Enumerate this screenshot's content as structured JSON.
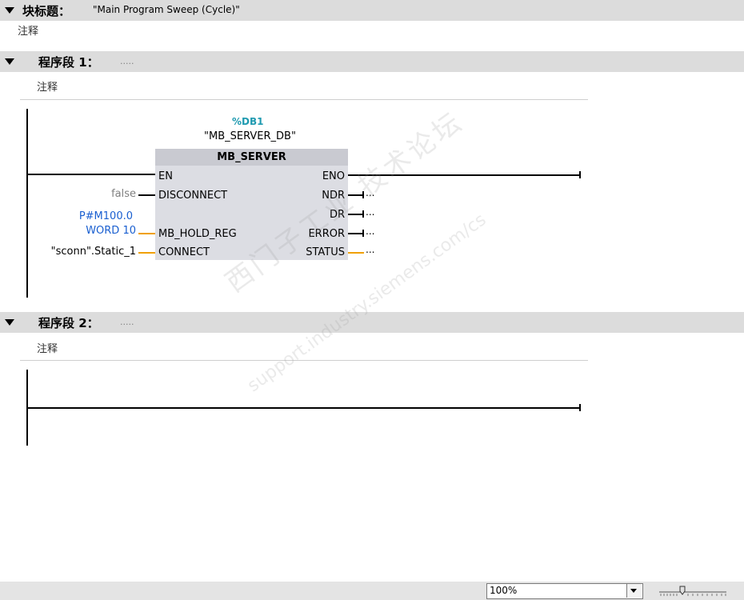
{
  "block": {
    "title_label": "块标题：",
    "title_value": "\"Main Program Sweep (Cycle)\"",
    "comment": "注释"
  },
  "networks": [
    {
      "label": "程序段 1：",
      "dots": ".....",
      "comment": "注释"
    },
    {
      "label": "程序段 2：",
      "dots": ".....",
      "comment": "注释"
    }
  ],
  "fb": {
    "db_address": "%DB1",
    "db_name": "\"MB_SERVER_DB\"",
    "name": "MB_SERVER",
    "inputs": {
      "en": "EN",
      "disconnect": "DISCONNECT",
      "mb_hold_reg": "MB_HOLD_REG",
      "connect": "CONNECT"
    },
    "outputs": {
      "eno": "ENO",
      "ndr": "NDR",
      "dr": "DR",
      "error": "ERROR",
      "status": "STATUS"
    },
    "params": {
      "disconnect": "false",
      "hold_reg_line1": "P#M100.0",
      "hold_reg_line2": "WORD 10",
      "connect": "\"sconn\".Static_1"
    },
    "open_output": "..."
  },
  "watermark": {
    "cn": "西门子工业 技术论坛",
    "url": "support.industry.siemens.com/cs"
  },
  "statusbar": {
    "zoom": "100%"
  }
}
